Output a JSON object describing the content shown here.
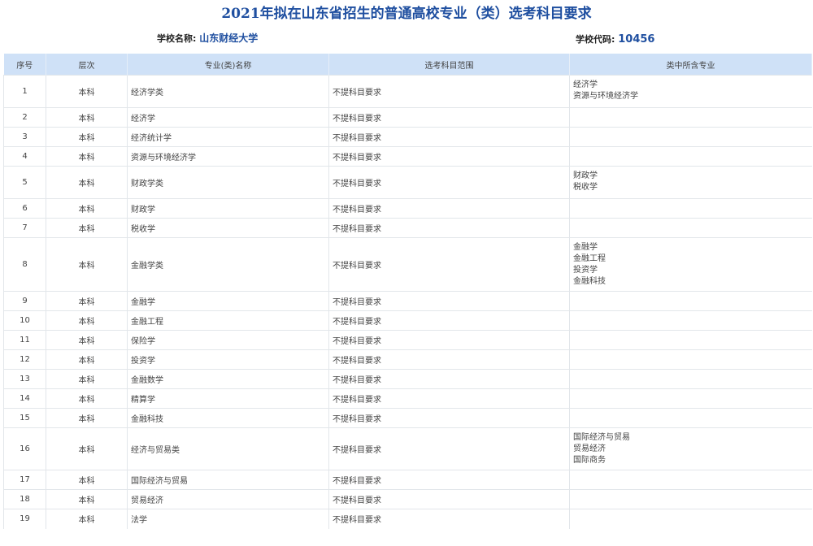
{
  "title": "2021年拟在山东省招生的普通高校专业（类）选考科目要求",
  "school": {
    "name_label": "学校名称:",
    "name": "山东财经大学",
    "code_label": "学校代码:",
    "code": "10456"
  },
  "headers": [
    "序号",
    "层次",
    "专业(类)名称",
    "选考科目范围",
    "类中所含专业"
  ],
  "rows": [
    {
      "no": "1",
      "level": "本科",
      "major": "经济学类",
      "req": "不提科目要求",
      "subs": [
        "经济学",
        "资源与环境经济学"
      ]
    },
    {
      "no": "2",
      "level": "本科",
      "major": "经济学",
      "req": "不提科目要求",
      "subs": []
    },
    {
      "no": "3",
      "level": "本科",
      "major": "经济统计学",
      "req": "不提科目要求",
      "subs": []
    },
    {
      "no": "4",
      "level": "本科",
      "major": "资源与环境经济学",
      "req": "不提科目要求",
      "subs": []
    },
    {
      "no": "5",
      "level": "本科",
      "major": "财政学类",
      "req": "不提科目要求",
      "subs": [
        "财政学",
        "税收学"
      ]
    },
    {
      "no": "6",
      "level": "本科",
      "major": "财政学",
      "req": "不提科目要求",
      "subs": []
    },
    {
      "no": "7",
      "level": "本科",
      "major": "税收学",
      "req": "不提科目要求",
      "subs": []
    },
    {
      "no": "8",
      "level": "本科",
      "major": "金融学类",
      "req": "不提科目要求",
      "subs": [
        "金融学",
        "金融工程",
        "投资学",
        "金融科技"
      ]
    },
    {
      "no": "9",
      "level": "本科",
      "major": "金融学",
      "req": "不提科目要求",
      "subs": []
    },
    {
      "no": "10",
      "level": "本科",
      "major": "金融工程",
      "req": "不提科目要求",
      "subs": []
    },
    {
      "no": "11",
      "level": "本科",
      "major": "保险学",
      "req": "不提科目要求",
      "subs": []
    },
    {
      "no": "12",
      "level": "本科",
      "major": "投资学",
      "req": "不提科目要求",
      "subs": []
    },
    {
      "no": "13",
      "level": "本科",
      "major": "金融数学",
      "req": "不提科目要求",
      "subs": []
    },
    {
      "no": "14",
      "level": "本科",
      "major": "精算学",
      "req": "不提科目要求",
      "subs": []
    },
    {
      "no": "15",
      "level": "本科",
      "major": "金融科技",
      "req": "不提科目要求",
      "subs": []
    },
    {
      "no": "16",
      "level": "本科",
      "major": "经济与贸易类",
      "req": "不提科目要求",
      "subs": [
        "国际经济与贸易",
        "贸易经济",
        "国际商务"
      ]
    },
    {
      "no": "17",
      "level": "本科",
      "major": "国际经济与贸易",
      "req": "不提科目要求",
      "subs": []
    },
    {
      "no": "18",
      "level": "本科",
      "major": "贸易经济",
      "req": "不提科目要求",
      "subs": []
    },
    {
      "no": "19",
      "level": "本科",
      "major": "法学",
      "req": "不提科目要求",
      "subs": []
    }
  ]
}
